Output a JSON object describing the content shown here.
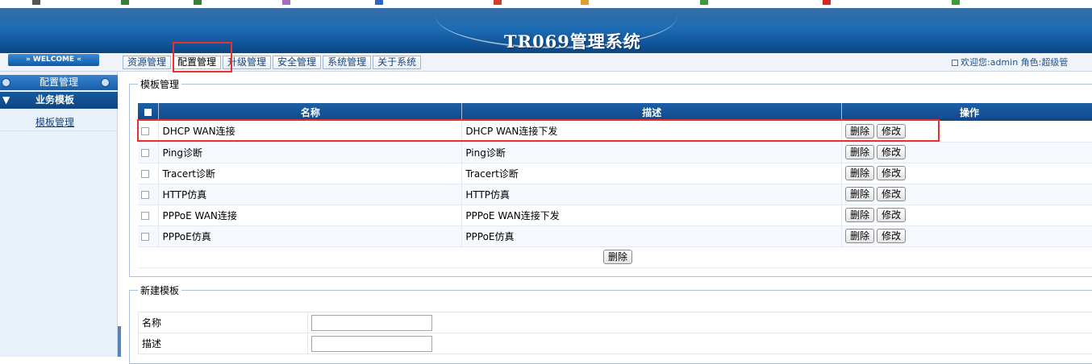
{
  "app": {
    "title": "TR069管理系统"
  },
  "colors": {
    "banner": "#1c6cb4",
    "header": "#0f4989",
    "highlight": "#e8322f"
  },
  "topbar": {
    "welcome": "» WELCOME «",
    "tabs": [
      "资源管理",
      "配置管理",
      "升级管理",
      "安全管理",
      "系统管理",
      "关于系统"
    ],
    "active_tab": "配置管理",
    "user_info": "欢迎您:admin 角色:超级管"
  },
  "sidebar": {
    "header": "配置管理",
    "section": "业务模板",
    "section_icon": "triangle-down",
    "items": [
      "模板管理"
    ]
  },
  "template_panel": {
    "legend": "模板管理",
    "columns": [
      "名称",
      "描述",
      "操作"
    ],
    "rows": [
      {
        "name": "DHCP WAN连接",
        "desc": "DHCP WAN连接下发"
      },
      {
        "name": "Ping诊断",
        "desc": "Ping诊断"
      },
      {
        "name": "Tracert诊断",
        "desc": "Tracert诊断"
      },
      {
        "name": "HTTP仿真",
        "desc": "HTTP仿真"
      },
      {
        "name": "PPPoE WAN连接",
        "desc": "PPPoE WAN连接下发"
      },
      {
        "name": "PPPoE仿真",
        "desc": "PPPoE仿真"
      }
    ],
    "row_actions": {
      "delete": "删除",
      "edit": "修改"
    },
    "bulk_delete": "删除"
  },
  "new_panel": {
    "legend": "新建模板",
    "fields": {
      "name_label": "名称",
      "name_value": "",
      "desc_label": "描述",
      "desc_value": ""
    }
  }
}
